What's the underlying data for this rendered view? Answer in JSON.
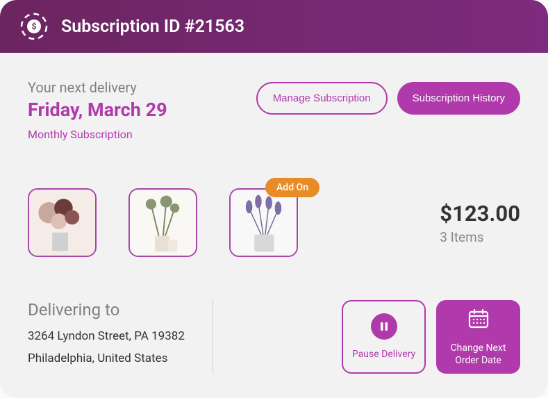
{
  "header": {
    "title": "Subscription ID #21563"
  },
  "delivery": {
    "label": "Your next delivery",
    "date": "Friday, March 29",
    "type": "Monthly Subscription"
  },
  "buttons": {
    "manage": "Manage Subscription",
    "history": "Subscription History"
  },
  "products": {
    "addon_label": "Add On"
  },
  "summary": {
    "price": "$123.00",
    "items": "3 Items"
  },
  "shipping": {
    "label": "Delivering to",
    "line1": "3264 Lyndon Street, PA 19382",
    "line2": "Philadelphia, United States"
  },
  "actions": {
    "pause": "Pause Delivery",
    "change_date": "Change Next Order Date"
  }
}
